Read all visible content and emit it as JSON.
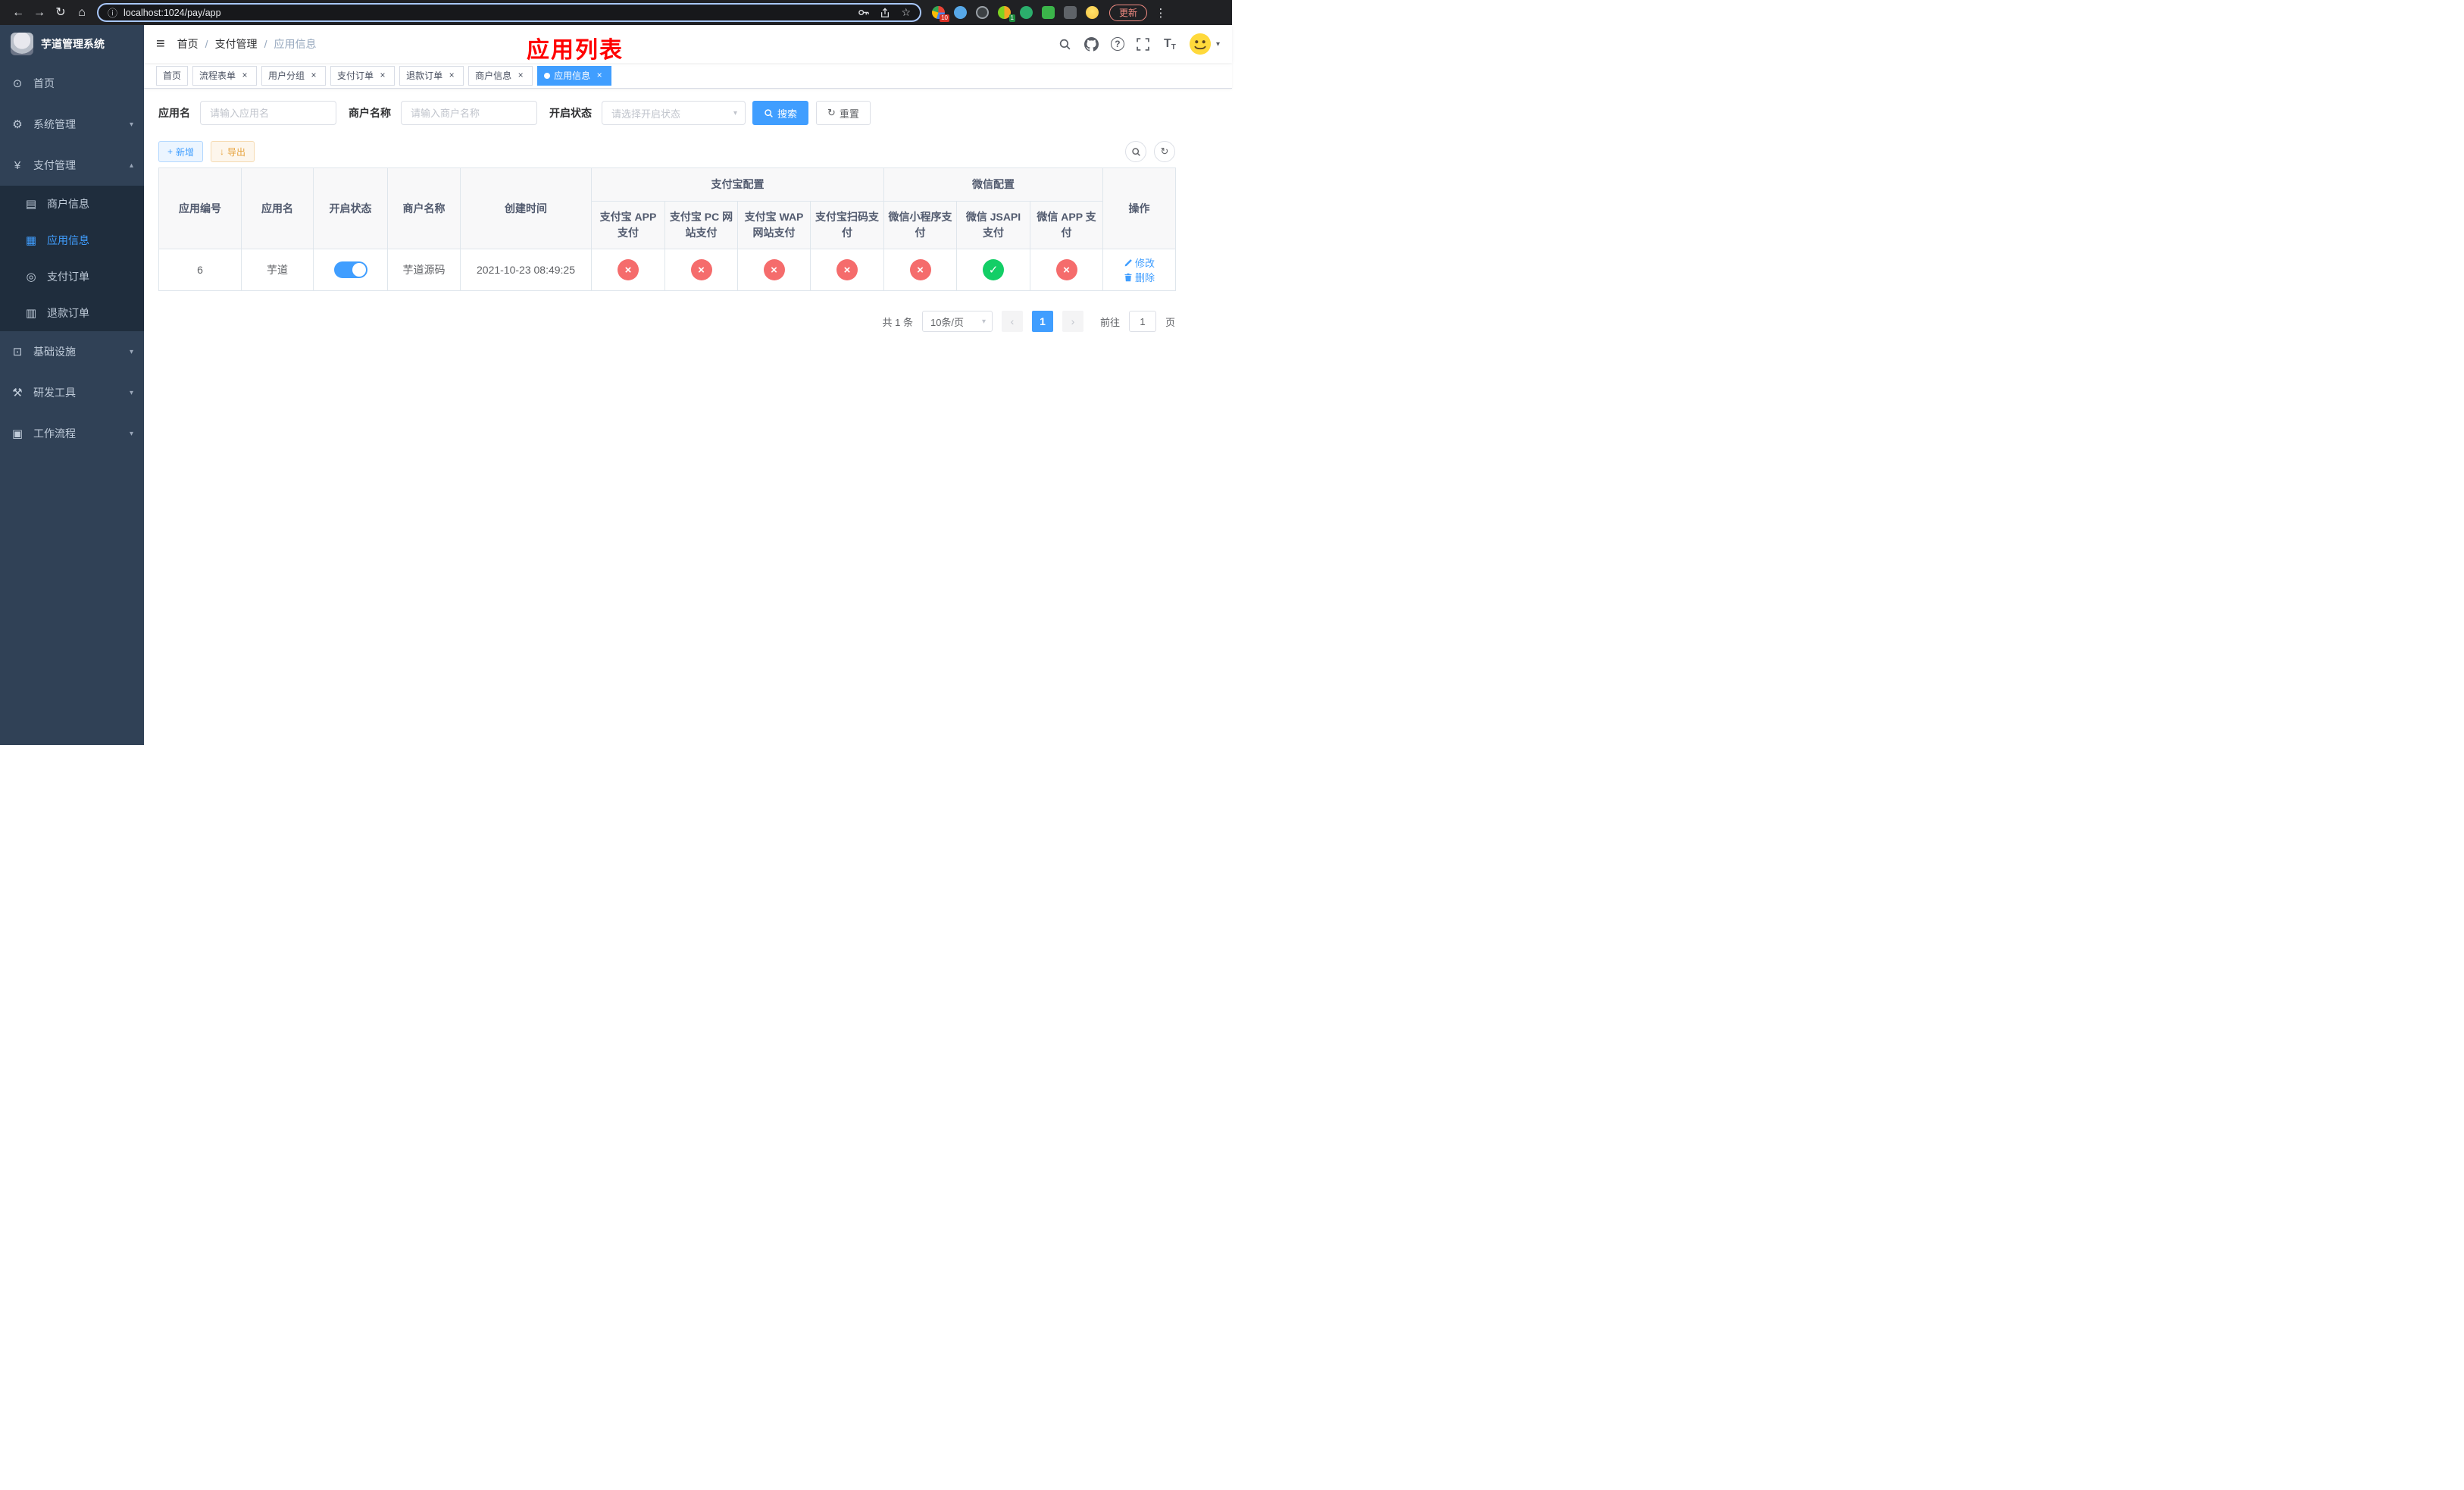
{
  "browser": {
    "url": "localhost:1024/pay/app",
    "update_label": "更新",
    "extension_badge_1": "10",
    "extension_badge_2": "1"
  },
  "icons": {
    "back": "←",
    "forward": "→",
    "reload": "↻",
    "home": "⌂",
    "info": "ⓘ",
    "star": "☆",
    "kebab": "⋮",
    "hamburger": "≡",
    "dashboard": "⊙",
    "gear": "⚙",
    "yen": "¥",
    "merchant": "▤",
    "app": "▦",
    "order": "◎",
    "refund": "▥",
    "infra": "⊡",
    "devtool": "⚒",
    "workflow": "▣",
    "chevron_down": "▾",
    "chevron_up": "▴",
    "close": "×",
    "plus": "+",
    "download": "↓",
    "refresh": "↻",
    "check": "✓",
    "cross": "×",
    "prev": "‹",
    "next": "›",
    "question": "?",
    "fontsize": "T"
  },
  "sidebar": {
    "logo_title": "芋道管理系统",
    "items": [
      {
        "label": "首页"
      },
      {
        "label": "系统管理"
      },
      {
        "label": "支付管理"
      },
      {
        "label": "基础设施"
      },
      {
        "label": "研发工具"
      },
      {
        "label": "工作流程"
      }
    ],
    "payment_children": [
      {
        "label": "商户信息"
      },
      {
        "label": "应用信息"
      },
      {
        "label": "支付订单"
      },
      {
        "label": "退款订单"
      }
    ]
  },
  "navbar": {
    "breadcrumb": [
      "首页",
      "支付管理",
      "应用信息"
    ],
    "separator": "/",
    "annotation": "应用列表"
  },
  "tabs": {
    "items": [
      {
        "label": "首页"
      },
      {
        "label": "流程表单"
      },
      {
        "label": "用户分组"
      },
      {
        "label": "支付订单"
      },
      {
        "label": "退款订单"
      },
      {
        "label": "商户信息"
      },
      {
        "label": "应用信息"
      }
    ]
  },
  "filters": {
    "app_name_label": "应用名",
    "app_name_placeholder": "请输入应用名",
    "merchant_label": "商户名称",
    "merchant_placeholder": "请输入商户名称",
    "status_label": "开启状态",
    "status_placeholder": "请选择开启状态",
    "search_label": "搜索",
    "reset_label": "重置"
  },
  "toolbar": {
    "add_label": "新增",
    "export_label": "导出"
  },
  "table": {
    "headers": {
      "app_id": "应用编号",
      "app_name": "应用名",
      "status": "开启状态",
      "merchant": "商户名称",
      "created": "创建时间",
      "alipay_group": "支付宝配置",
      "wechat_group": "微信配置",
      "alipay_app": "支付宝 APP 支付",
      "alipay_pc": "支付宝 PC 网站支付",
      "alipay_wap": "支付宝 WAP 网站支付",
      "alipay_scan": "支付宝扫码支付",
      "wx_lite": "微信小程序支付",
      "wx_jsapi": "微信 JSAPI 支付",
      "wx_app": "微信 APP 支付",
      "actions": "操作"
    },
    "rows": [
      {
        "app_id": "6",
        "app_name": "芋道",
        "status_on": true,
        "merchant": "芋道源码",
        "created": "2021-10-23 08:49:25",
        "configs": [
          "no",
          "no",
          "no",
          "no",
          "no",
          "yes",
          "no"
        ],
        "edit_label": "修改",
        "delete_label": "删除"
      }
    ]
  },
  "pagination": {
    "total": "共 1 条",
    "page_size": "10条/页",
    "current_page": "1",
    "goto_label": "前往",
    "goto_value": "1",
    "page_label": "页"
  }
}
